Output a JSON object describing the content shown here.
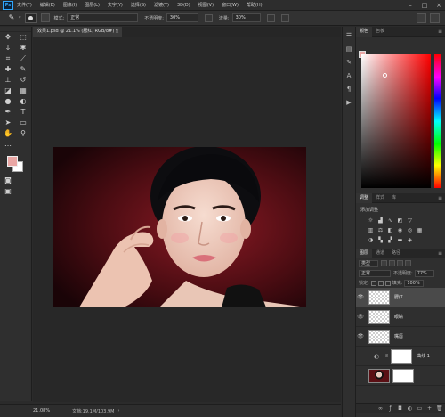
{
  "app": {
    "logo": "Ps"
  },
  "menu": [
    "文件(F)",
    "编辑(E)",
    "图像(I)",
    "图层(L)",
    "文字(Y)",
    "选择(S)",
    "滤镜(T)",
    "3D(D)",
    "视图(V)",
    "窗口(W)",
    "帮助(H)"
  ],
  "options": {
    "mode_label": "模式:",
    "mode_value": "正常",
    "opacity_label": "不透明度:",
    "opacity_value": "30%",
    "flow_label": "流量:",
    "flow_value": "30%"
  },
  "document": {
    "tab_title": "效果1.psd @ 21.1% (腮红, RGB/8#) *",
    "zoom": "21.08%",
    "info": "文档:19.1M/103.9M"
  },
  "colors": {
    "foreground": "#e9a6a4",
    "background": "#ffffff"
  },
  "panels": {
    "color_tabs": [
      "颜色",
      "色板"
    ],
    "adjust_tabs": [
      "调整",
      "样式",
      "库"
    ],
    "adjust_title": "添加调整",
    "layers_tabs": [
      "图层",
      "通道",
      "路径"
    ],
    "kind": "类型",
    "blend_mode": "正常",
    "opacity_label": "不透明度:",
    "opacity_value": "77%",
    "lock_label": "锁定:",
    "fill_label": "填充:",
    "fill_value": "100%"
  },
  "layers": [
    {
      "name": "腮红",
      "selected": true,
      "visible": true
    },
    {
      "name": "眼睛",
      "selected": false,
      "visible": true
    },
    {
      "name": "嘴唇",
      "selected": false,
      "visible": true
    },
    {
      "name": "曲线 1",
      "selected": false,
      "visible": false
    },
    {
      "name": "",
      "selected": false,
      "visible": false
    }
  ]
}
